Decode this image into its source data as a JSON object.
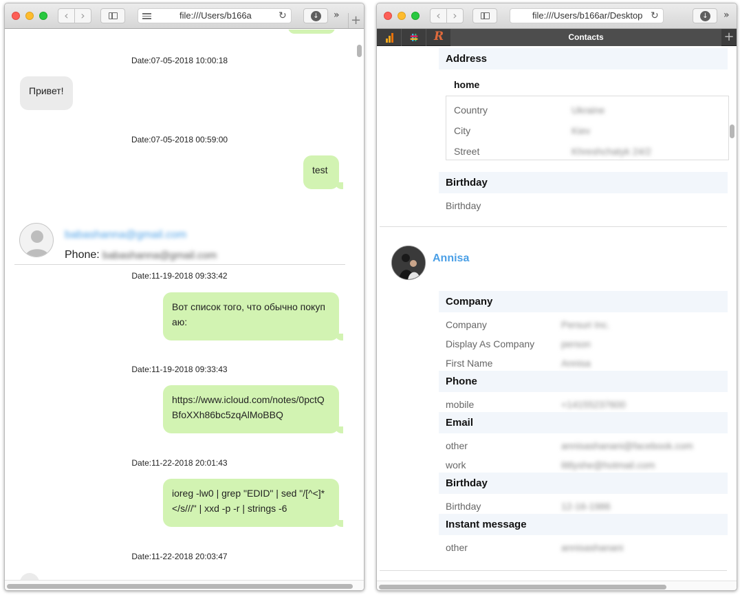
{
  "left_window": {
    "url": "file:///Users/b166a",
    "messages": [
      {
        "date": "Date:07-05-2018 10:00:18",
        "text": "Привет!",
        "direction": "in"
      },
      {
        "date": "Date:07-05-2018 00:59:00",
        "text": "test",
        "direction": "out"
      },
      {
        "date": "Date:11-19-2018 09:33:42",
        "line1": "Вот список того, что обычно покуп",
        "line2": "аю:",
        "direction": "out"
      },
      {
        "date": "Date:11-19-2018 09:33:43",
        "line1": "https://www.icloud.com/notes/0pctQ",
        "line2": "BfoXXh86bc5zqAlMoBBQ",
        "direction": "out"
      },
      {
        "date": "Date:11-22-2018 20:01:43",
        "line1": "ioreg -lw0 | grep \"EDID\" | sed \"/[^<]*",
        "line2": "</s///\" | xxd -p -r | strings -6",
        "direction": "out"
      },
      {
        "date": "Date:11-22-2018 20:03:47"
      }
    ],
    "contact_header": {
      "email": "babashanna@gmail.com",
      "phone_label": "Phone:",
      "phone_value": "babashanna@gmail.com"
    }
  },
  "right_window": {
    "url": "file:///Users/b166ar/Desktop",
    "active_tab": "Contacts",
    "address": {
      "title": "Address",
      "subtitle": "home",
      "rows": [
        {
          "label": "Country",
          "value": "Ukraine"
        },
        {
          "label": "City",
          "value": "Kiev"
        },
        {
          "label": "Street",
          "value": "Khreshchatyk 24/2"
        }
      ]
    },
    "birthday_1": {
      "title": "Birthday",
      "label": "Birthday"
    },
    "contact_name": "Annisa",
    "company": {
      "title": "Company",
      "rows": [
        {
          "label": "Company",
          "value": "Persuri Inc."
        },
        {
          "label": "Display As Company",
          "value": "person"
        },
        {
          "label": "First Name",
          "value": "Annisa"
        }
      ]
    },
    "phone": {
      "title": "Phone",
      "rows": [
        {
          "label": "mobile",
          "value": "+14155237600"
        }
      ]
    },
    "email": {
      "title": "Email",
      "rows": [
        {
          "label": "other",
          "value": "annisashanani@facebook.com"
        },
        {
          "label": "work",
          "value": "littlyshe@hotmail.com"
        }
      ]
    },
    "birthday_2": {
      "title": "Birthday",
      "rows": [
        {
          "label": "Birthday",
          "value": "12-16-1986"
        }
      ]
    },
    "instant_message": {
      "title": "Instant message",
      "rows": [
        {
          "label": "other",
          "value": "annisashanani"
        }
      ]
    }
  },
  "colors": {
    "incoming_bubble": "#ebebeb",
    "outgoing_bubble": "#d2f3b2",
    "link_blue": "#4a9fe6",
    "section_bg": "#f2f6fb"
  }
}
